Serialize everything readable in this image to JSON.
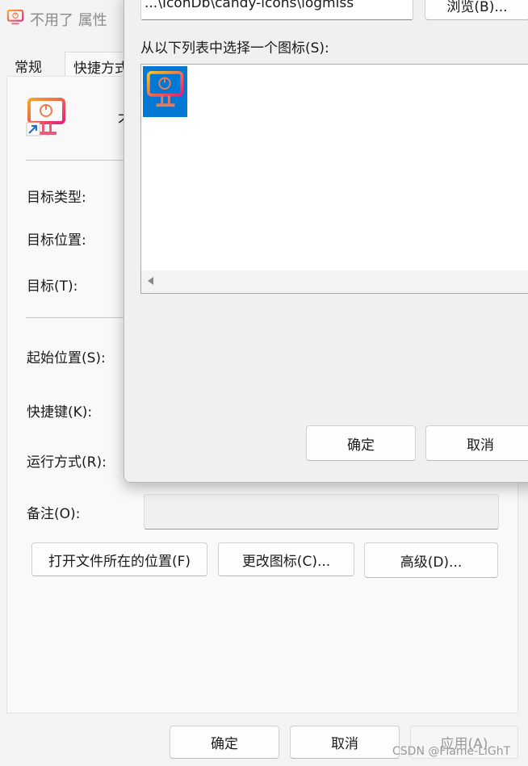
{
  "window": {
    "title": "不用了 属性",
    "tabs": {
      "general": "常规",
      "shortcut": "快捷方式"
    },
    "name_fragment": "不",
    "fields": {
      "target_type": "目标类型:",
      "target_location": "目标位置:",
      "target": "目标(T):",
      "start_in": "起始位置(S):",
      "shortcut_key": "快捷键(K):",
      "run": "运行方式(R):",
      "comment": "备注(O):"
    },
    "buttons": {
      "open_location": "打开文件所在的位置(F)",
      "change_icon": "更改图标(C)...",
      "advanced": "高级(D)...",
      "ok": "确定",
      "cancel": "取消",
      "apply": "应用(A)"
    }
  },
  "dialog": {
    "path_value": "...\\IconDb\\candy-icons\\logmiss",
    "browse_label": "浏览(B)...",
    "list_label": "从以下列表中选择一个图标(S):",
    "ok_label": "确定",
    "cancel_label": "取消",
    "icons": [
      {
        "icon": "monitor-power-icon",
        "selected": true
      }
    ]
  },
  "watermark": "CSDN @Flame-LiGhT",
  "colors": {
    "selection": "#0078d4",
    "icon_gradient_start": "#f5a623",
    "icon_gradient_end": "#e8207a",
    "disabled_text": "#9a9a9a"
  }
}
